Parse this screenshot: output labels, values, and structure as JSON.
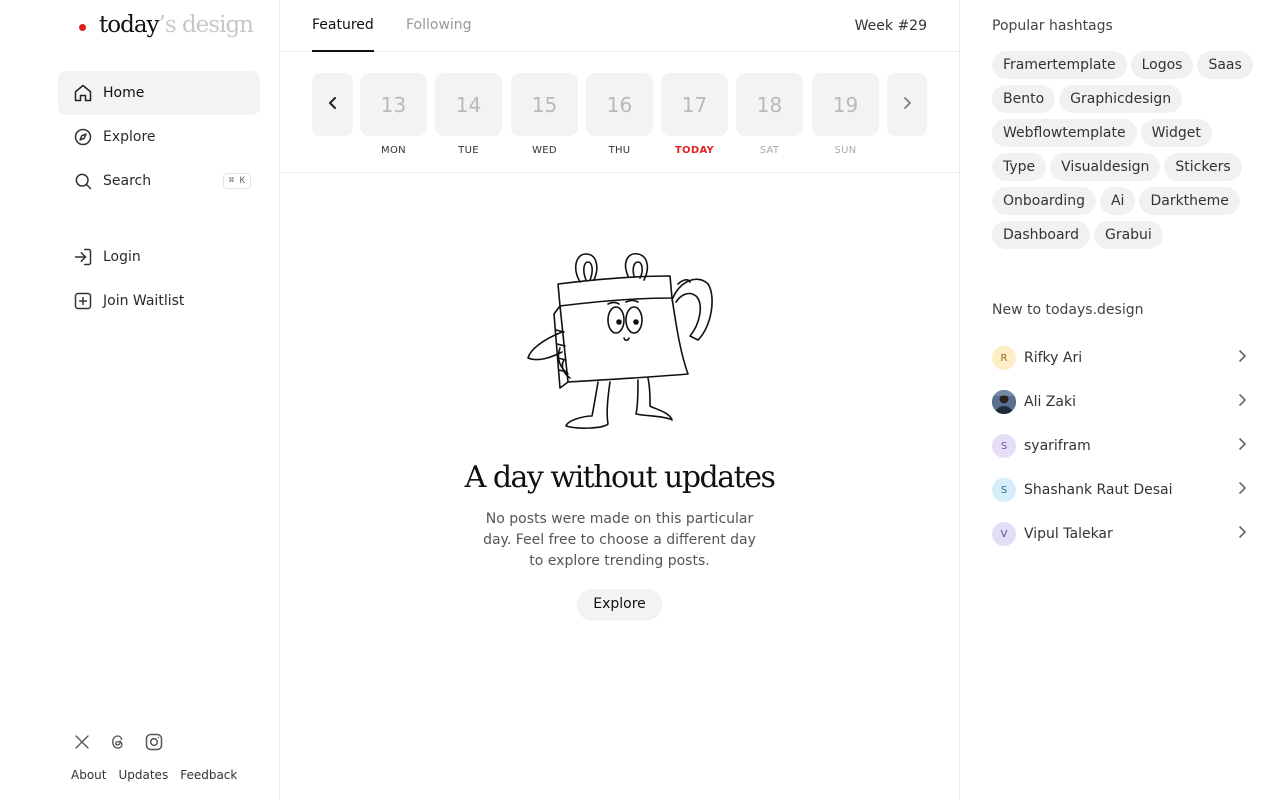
{
  "logo": {
    "main": "today",
    "rest": "’s design",
    "dot_color": "#e01e1e"
  },
  "nav": {
    "home": "Home",
    "explore": "Explore",
    "search": "Search",
    "search_shortcut": "⌘ K",
    "login": "Login",
    "join_waitlist": "Join Waitlist"
  },
  "footer": {
    "about": "About",
    "updates": "Updates",
    "feedback": "Feedback"
  },
  "tabs": {
    "featured": "Featured",
    "following": "Following",
    "week": "Week #29"
  },
  "days": [
    {
      "num": "13",
      "label": "MON"
    },
    {
      "num": "14",
      "label": "TUE"
    },
    {
      "num": "15",
      "label": "WED"
    },
    {
      "num": "16",
      "label": "THU"
    },
    {
      "num": "17",
      "label": "TODAY"
    },
    {
      "num": "18",
      "label": "SAT"
    },
    {
      "num": "19",
      "label": "SUN"
    }
  ],
  "empty_state": {
    "title": "A day without updates",
    "text": "No posts were made on this particular day. Feel free to choose a different day to explore trending posts.",
    "button": "Explore"
  },
  "hashtags": {
    "title": "Popular hashtags",
    "items": [
      "Framertemplate",
      "Logos",
      "Saas",
      "Bento",
      "Graphicdesign",
      "Webflowtemplate",
      "Widget",
      "Type",
      "Visualdesign",
      "Stickers",
      "Onboarding",
      "Ai",
      "Darktheme",
      "Dashboard",
      "Grabui"
    ]
  },
  "new_users": {
    "title": "New to todays.design",
    "items": [
      {
        "initial": "R",
        "name": "Rifky Ari",
        "color": "#fdeec7"
      },
      {
        "initial": "",
        "name": "Ali Zaki",
        "color": "#3b4a63"
      },
      {
        "initial": "S",
        "name": "syarifram",
        "color": "#e6def7"
      },
      {
        "initial": "S",
        "name": "Shashank Raut Desai",
        "color": "#d5eefa"
      },
      {
        "initial": "V",
        "name": "Vipul Talekar",
        "color": "#e3ddf7"
      }
    ]
  }
}
